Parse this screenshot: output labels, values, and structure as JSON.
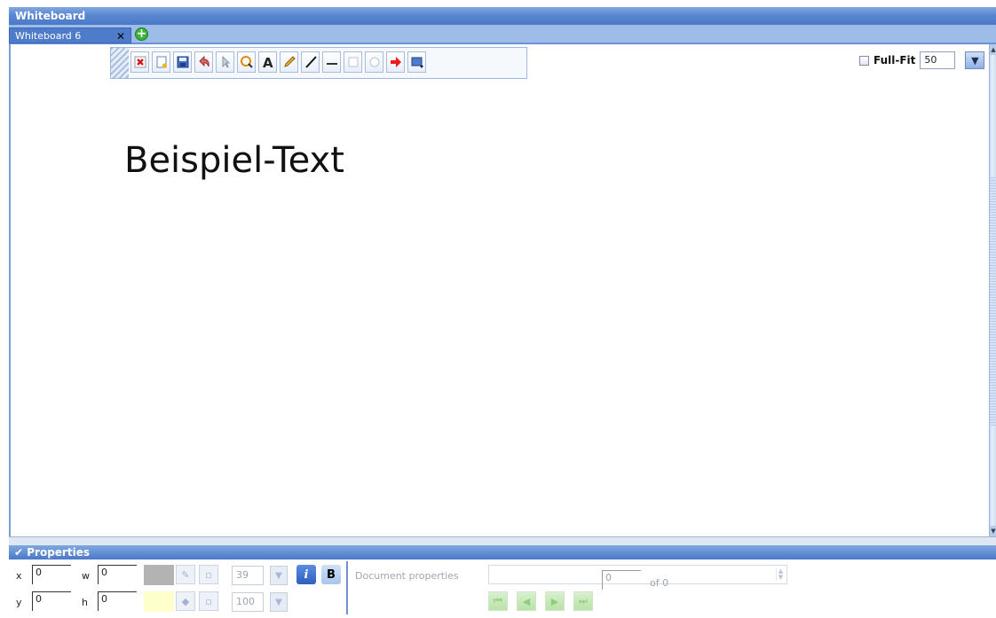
{
  "window": {
    "title": "Whiteboard"
  },
  "tabs": [
    {
      "label": "Whiteboard 6",
      "close": "✕"
    }
  ],
  "canvas": {
    "sample_text": "Beispiel-Text"
  },
  "zoom": {
    "full_fit_label": "Full-Fit",
    "value": "50",
    "drop": "▼"
  },
  "properties": {
    "header": "Properties",
    "x_label": "x",
    "x_value": "0",
    "y_label": "y",
    "y_value": "0",
    "w_label": "w",
    "w_value": "0",
    "h_label": "h",
    "h_value": "0",
    "font_size": "39",
    "opacity": "100",
    "italic_label": "i",
    "bold_label": "B",
    "document_properties_label": "Document properties",
    "page_value": "0",
    "of_label": "of 0"
  },
  "colors": {
    "title_bar": "#5a86cf",
    "tab_active": "#4f7cca",
    "line_swatch": "#b3b3b3",
    "fill_swatch": "#ffffcc"
  }
}
